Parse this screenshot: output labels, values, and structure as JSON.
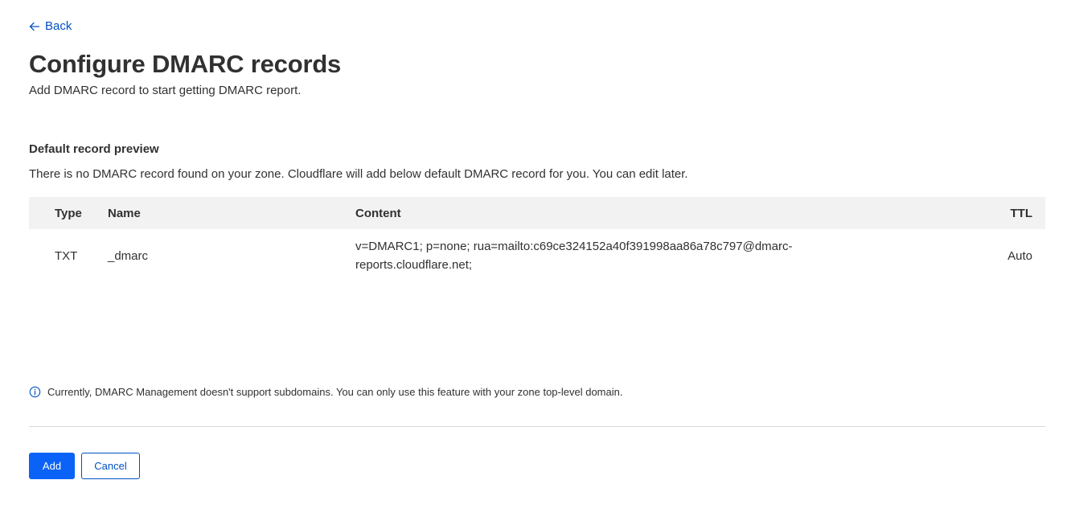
{
  "nav": {
    "back_label": "Back"
  },
  "header": {
    "title": "Configure DMARC records",
    "subtitle": "Add DMARC record to start getting DMARC report."
  },
  "preview": {
    "title": "Default record preview",
    "description": "There is no DMARC record found on your zone. Cloudflare will add below default DMARC record for you. You can edit later."
  },
  "table": {
    "columns": [
      "Type",
      "Name",
      "Content",
      "TTL"
    ],
    "rows": [
      {
        "type": "TXT",
        "name": "_dmarc",
        "content": "v=DMARC1; p=none; rua=mailto:c69ce324152a40f391998aa86a78c797@dmarc-reports.cloudflare.net;",
        "ttl": "Auto"
      }
    ]
  },
  "note": {
    "icon": "info-icon",
    "text": "Currently, DMARC Management doesn't support subdomains. You can only use this feature with your zone top-level domain."
  },
  "actions": {
    "add_label": "Add",
    "cancel_label": "Cancel"
  },
  "colors": {
    "link": "#0051c3",
    "primary_button": "#0a63f6",
    "table_header_bg": "#f2f2f2",
    "text": "#313131"
  }
}
